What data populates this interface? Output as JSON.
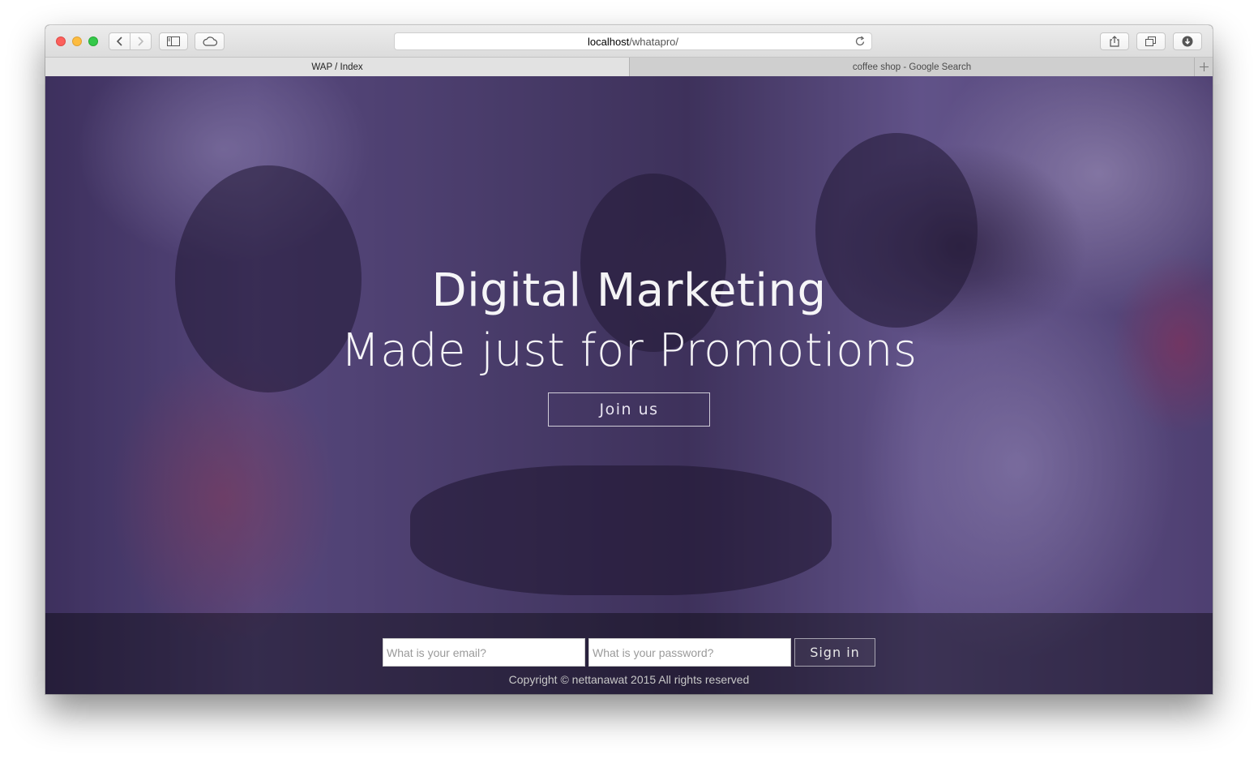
{
  "browser": {
    "address": {
      "host": "localhost",
      "path": "/whatapro/"
    },
    "tabs": [
      {
        "label": "WAP / Index",
        "active": true
      },
      {
        "label": "coffee shop - Google Search",
        "active": false
      }
    ]
  },
  "hero": {
    "line1": "Digital Marketing",
    "line2": "Made just for Promotions",
    "join_label": "Join us"
  },
  "signin": {
    "email_placeholder": "What is your email?",
    "password_placeholder": "What is your password?",
    "button_label": "Sign in"
  },
  "footer": {
    "copyright": "Copyright © nettanawat 2015 All rights reserved"
  },
  "colors": {
    "overlay_tint": "#463278",
    "text_white": "#ffffff"
  }
}
